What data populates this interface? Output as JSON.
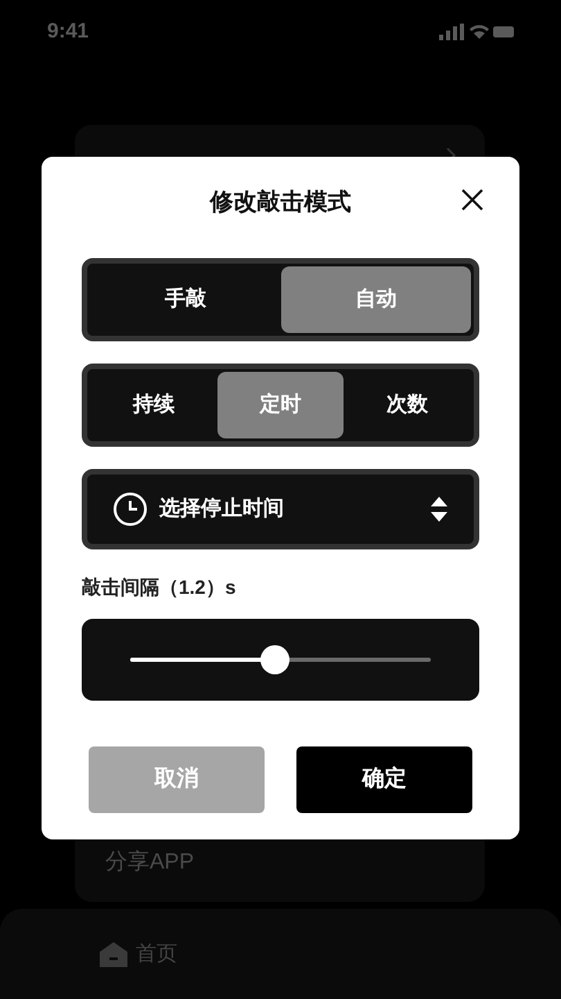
{
  "status_bar": {
    "time": "9:41"
  },
  "background": {
    "share_item": "分享APP",
    "tab_bar": [
      {
        "label": "首页",
        "selected": true
      }
    ]
  },
  "dialog": {
    "title": "修改敲击模式",
    "mode_tabs": [
      {
        "label": "手敲",
        "selected": false
      },
      {
        "label": "自动",
        "selected": true
      }
    ],
    "stop_tabs": [
      {
        "label": "持续",
        "selected": false
      },
      {
        "label": "定时",
        "selected": true
      },
      {
        "label": "次数",
        "selected": false
      }
    ],
    "stop_time": {
      "placeholder": "选择停止时间"
    },
    "interval_label": "敲击间隔（1.2）s",
    "slider": {
      "level": 0.48
    },
    "buttons": [
      {
        "label": "取消",
        "kind": "cancel"
      },
      {
        "label": "确定",
        "kind": "confirm"
      }
    ]
  }
}
